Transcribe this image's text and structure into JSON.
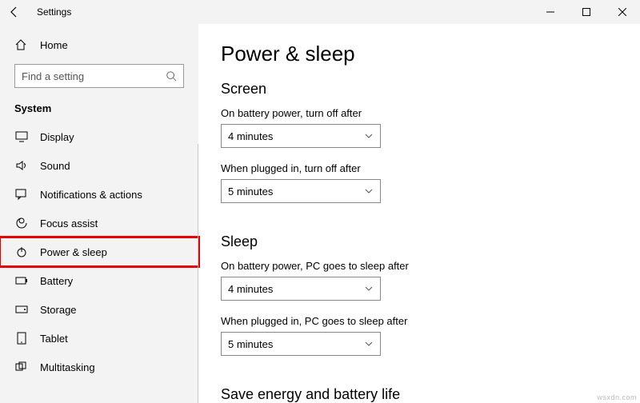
{
  "window": {
    "title": "Settings"
  },
  "sidebar": {
    "home_label": "Home",
    "search_placeholder": "Find a setting",
    "heading": "System",
    "items": [
      {
        "label": "Display"
      },
      {
        "label": "Sound"
      },
      {
        "label": "Notifications & actions"
      },
      {
        "label": "Focus assist"
      },
      {
        "label": "Power & sleep"
      },
      {
        "label": "Battery"
      },
      {
        "label": "Storage"
      },
      {
        "label": "Tablet"
      },
      {
        "label": "Multitasking"
      }
    ]
  },
  "main": {
    "title": "Power & sleep",
    "screen": {
      "heading": "Screen",
      "battery_label": "On battery power, turn off after",
      "battery_value": "4 minutes",
      "plugged_label": "When plugged in, turn off after",
      "plugged_value": "5 minutes"
    },
    "sleep": {
      "heading": "Sleep",
      "battery_label": "On battery power, PC goes to sleep after",
      "battery_value": "4 minutes",
      "plugged_label": "When plugged in, PC goes to sleep after",
      "plugged_value": "5 minutes"
    },
    "footer_heading": "Save energy and battery life"
  },
  "watermark": "wsxdn.com"
}
